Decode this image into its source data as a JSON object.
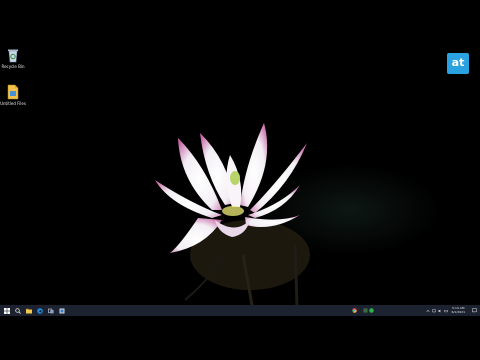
{
  "desktop": {
    "icons": [
      {
        "label": "Recycle Bin",
        "icon": "recycle-bin-icon"
      },
      {
        "label": "Untitled Files",
        "icon": "file-icon"
      }
    ],
    "brand_badge": "at",
    "wallpaper": "lotus-flower"
  },
  "taskbar": {
    "buttons": [
      "windows-start-icon",
      "search-icon",
      "task-view-icon",
      "file-explorer-icon",
      "edge-icon",
      "app-icon"
    ],
    "tray_apps": [
      "chrome-icon",
      "app-icon",
      "status-icon"
    ],
    "clock": {
      "time": "5:14 AM",
      "date": "6/1/2021"
    },
    "colors": {
      "bar": "#1c2230",
      "accent": "#2aa1e0"
    }
  }
}
